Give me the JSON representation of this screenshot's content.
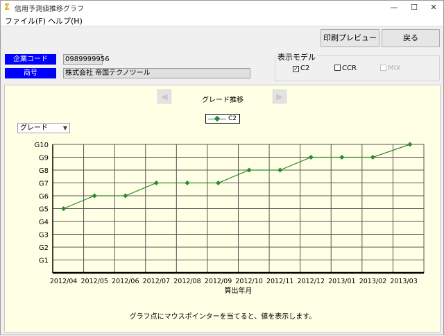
{
  "window": {
    "title": "信用予測値推移グラフ",
    "min": "—",
    "max": "☐",
    "close": "✕"
  },
  "menu": {
    "file": "ファイル(F)",
    "help": "ヘルプ(H)"
  },
  "toolbar": {
    "print_preview": "印刷プレビュー",
    "back": "戻る"
  },
  "company": {
    "code_label": "企業コード",
    "code_value": "0989999956",
    "name_label": "商号",
    "name_value": "株式会社 帝国テクノツール"
  },
  "display_model": {
    "title": "表示モデル",
    "options": [
      {
        "label": "C2",
        "checked": true,
        "disabled": false
      },
      {
        "label": "CCR",
        "checked": false,
        "disabled": false
      },
      {
        "label": "MIX",
        "checked": false,
        "disabled": true
      }
    ]
  },
  "chart_controls": {
    "title": "グレード推移",
    "select_value": "グレード",
    "hint": "グラフ点にマウスポインターを当てると、値を表示します。"
  },
  "colors": {
    "series": "#2a8a2a",
    "panel_bg": "#ffffe6",
    "label_bg": "#0000ff"
  },
  "chart_data": {
    "type": "line",
    "xlabel": "算出年月",
    "ylabel": "",
    "categories": [
      "2012/04",
      "2012/05",
      "2012/06",
      "2012/07",
      "2012/08",
      "2012/09",
      "2012/10",
      "2012/11",
      "2012/12",
      "2013/01",
      "2013/02",
      "2013/03"
    ],
    "y_ticks": [
      "G1",
      "G2",
      "G3",
      "G4",
      "G5",
      "G6",
      "G7",
      "G8",
      "G9",
      "G10"
    ],
    "ylim": [
      1,
      10
    ],
    "series": [
      {
        "name": "C2",
        "values": [
          5,
          6,
          6,
          7,
          7,
          7,
          8,
          8,
          9,
          9,
          9,
          10
        ]
      }
    ],
    "x_points": [
      0,
      1,
      2,
      3,
      4,
      5,
      6,
      7,
      8,
      9,
      10,
      11.2
    ],
    "grid": true,
    "legend": "top-center"
  }
}
